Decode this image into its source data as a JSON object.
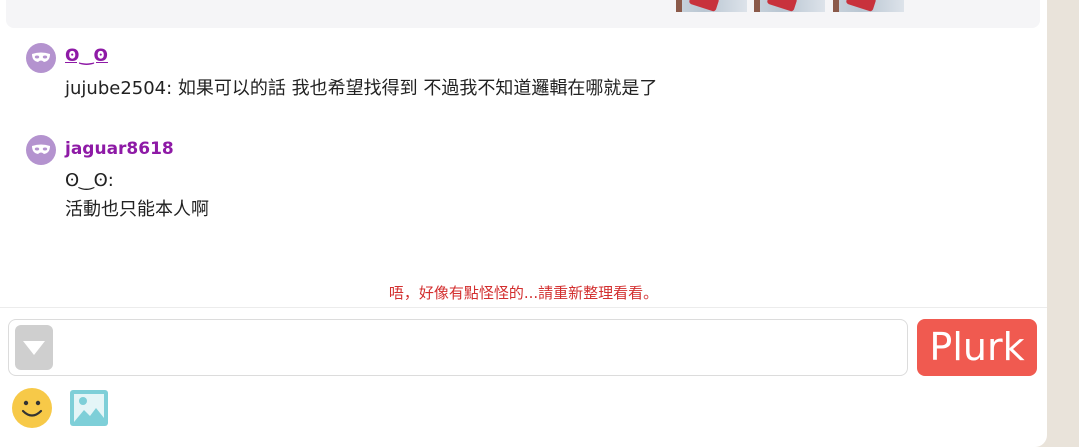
{
  "chat": {
    "messages": [
      {
        "nickname": "ʘ‿ʘ",
        "lines": [
          "jujube2504: 如果可以的話 我也希望找得到 不過我不知道邏輯在哪就是了"
        ]
      },
      {
        "nickname": "jaguar8618",
        "lines": [
          "ʘ‿ʘ:",
          "活動也只能本人啊"
        ]
      }
    ],
    "error_text": "唔，好像有點怪怪的...請重新整理看看。"
  },
  "composer": {
    "placeholder": "",
    "submit_label": "Plurk"
  },
  "colors": {
    "nickname": "#8e1aa6",
    "submit": "#f05a50",
    "error": "#d32f2f",
    "avatar": "#b493cf"
  },
  "icons": [
    "mask-icon",
    "dropdown-arrow-icon",
    "smiley-icon",
    "image-upload-icon"
  ]
}
